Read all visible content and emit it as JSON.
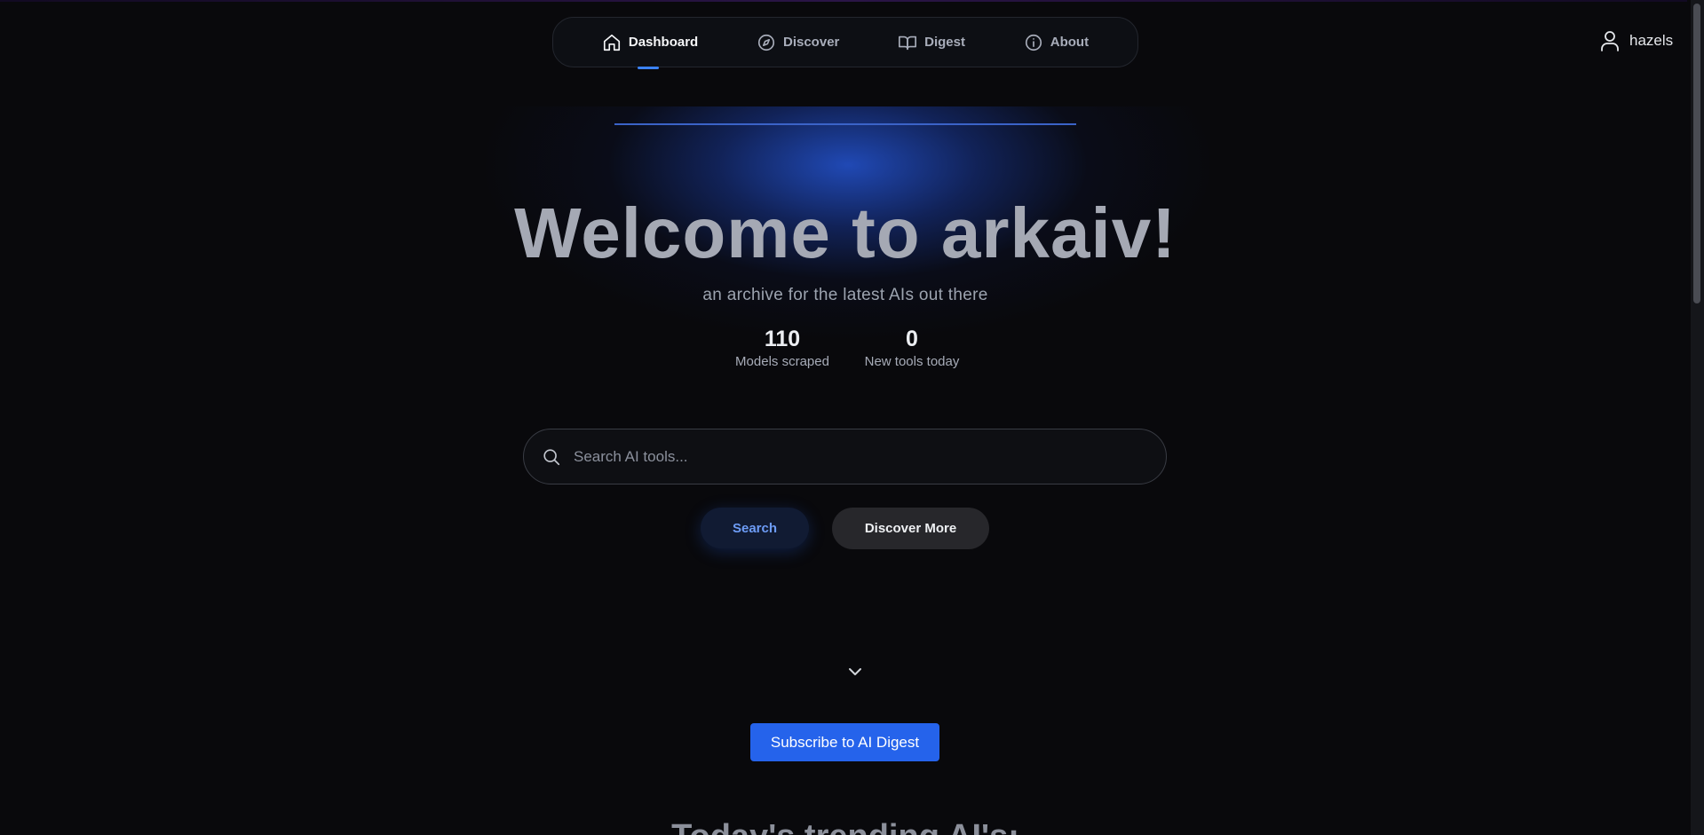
{
  "nav": {
    "items": [
      {
        "label": "Dashboard",
        "icon": "home-icon",
        "active": true
      },
      {
        "label": "Discover",
        "icon": "compass-icon",
        "active": false
      },
      {
        "label": "Digest",
        "icon": "book-icon",
        "active": false
      },
      {
        "label": "About",
        "icon": "info-icon",
        "active": false
      }
    ]
  },
  "user": {
    "name": "hazels",
    "icon": "user-icon"
  },
  "hero": {
    "title": "Welcome to arkaiv!",
    "subtitle": "an archive for the latest AIs out there"
  },
  "stats": [
    {
      "value": "110",
      "label": "Models scraped"
    },
    {
      "value": "0",
      "label": "New tools today"
    }
  ],
  "search": {
    "placeholder": "Search AI tools...",
    "value": ""
  },
  "buttons": {
    "search": "Search",
    "discover_more": "Discover More",
    "subscribe": "Subscribe to AI Digest"
  },
  "trending_heading": "Today's trending AI's:",
  "colors": {
    "background": "#09090c",
    "accent": "#2563eb",
    "glow": "#2454d2"
  }
}
